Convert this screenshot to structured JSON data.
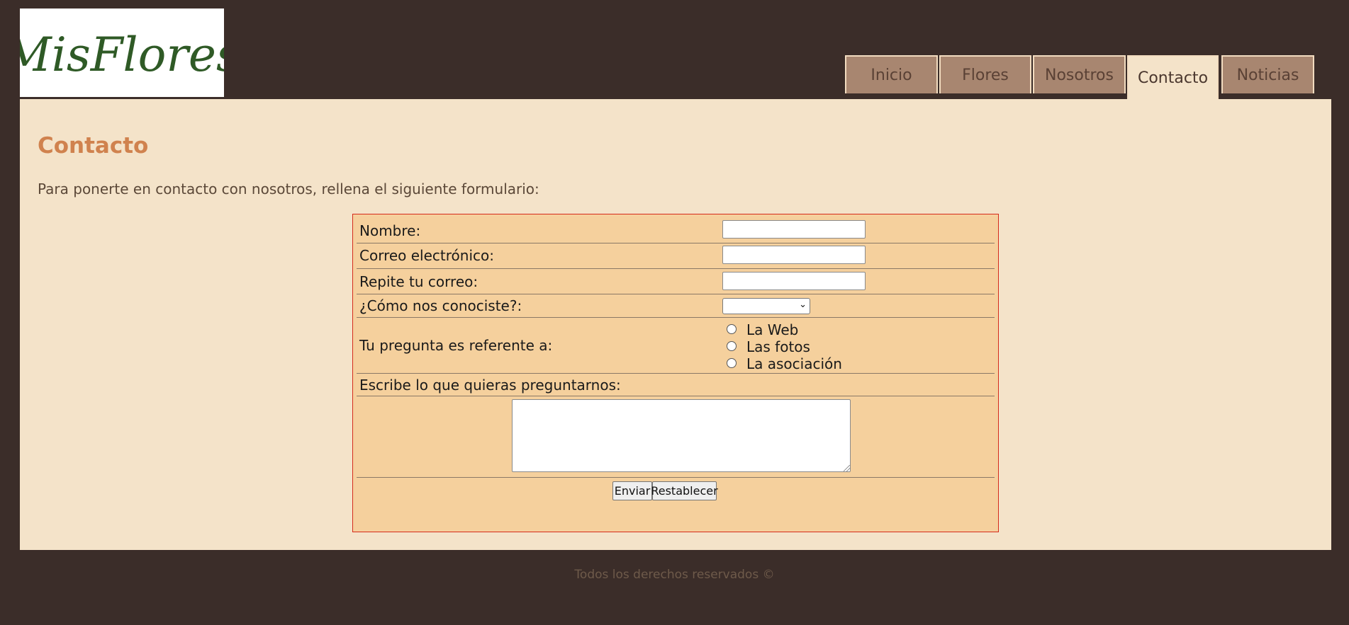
{
  "logo": {
    "text": "MisFlores",
    "color": "#2f5a26"
  },
  "nav": {
    "tabs": [
      {
        "label": "Inicio",
        "active": false
      },
      {
        "label": "Flores",
        "active": false
      },
      {
        "label": "Nosotros",
        "active": false
      },
      {
        "label": "Contacto",
        "active": true
      },
      {
        "label": "Noticias",
        "active": false
      }
    ]
  },
  "page": {
    "title": "Contacto",
    "intro": "Para ponerte en contacto con nosotros, rellena el siguiente formulario:"
  },
  "form": {
    "name_label": "Nombre:",
    "name_value": "",
    "email_label": "Correo electrónico:",
    "email_value": "",
    "repeat_email_label": "Repite tu correo:",
    "repeat_email_value": "",
    "source_label": "¿Cómo nos conociste?:",
    "source_selected": "",
    "topic_label": "Tu pregunta es referente a:",
    "topic_options": [
      "La Web",
      "Las fotos",
      "La asociación"
    ],
    "message_label": "Escribe lo que quieras preguntarnos:",
    "message_value": "",
    "submit_label": "Enviar",
    "reset_label": "Restablecer"
  },
  "footer": {
    "text": "Todos los derechos reservados ©"
  },
  "colors": {
    "background": "#3b2d29",
    "content": "#f4e3c9",
    "heading": "#d0824e",
    "form_bg": "#f5d09d",
    "form_border": "#d52a1a",
    "tab_bg": "#a88670"
  }
}
